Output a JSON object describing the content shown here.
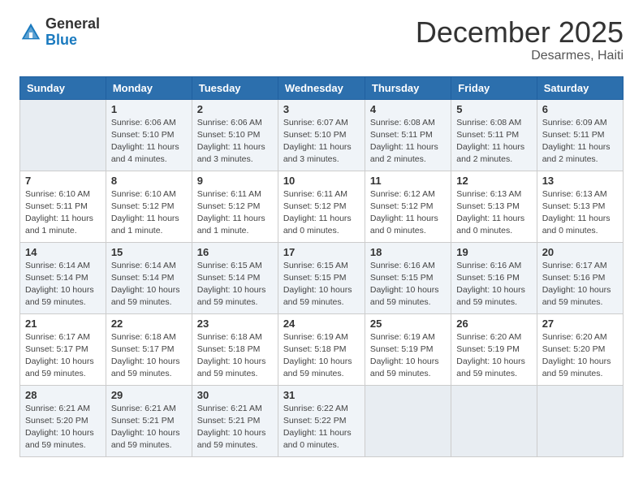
{
  "header": {
    "logo_general": "General",
    "logo_blue": "Blue",
    "title": "December 2025",
    "subtitle": "Desarmes, Haiti"
  },
  "columns": [
    "Sunday",
    "Monday",
    "Tuesday",
    "Wednesday",
    "Thursday",
    "Friday",
    "Saturday"
  ],
  "weeks": [
    [
      {
        "day": "",
        "info": ""
      },
      {
        "day": "1",
        "info": "Sunrise: 6:06 AM\nSunset: 5:10 PM\nDaylight: 11 hours\nand 4 minutes."
      },
      {
        "day": "2",
        "info": "Sunrise: 6:06 AM\nSunset: 5:10 PM\nDaylight: 11 hours\nand 3 minutes."
      },
      {
        "day": "3",
        "info": "Sunrise: 6:07 AM\nSunset: 5:10 PM\nDaylight: 11 hours\nand 3 minutes."
      },
      {
        "day": "4",
        "info": "Sunrise: 6:08 AM\nSunset: 5:11 PM\nDaylight: 11 hours\nand 2 minutes."
      },
      {
        "day": "5",
        "info": "Sunrise: 6:08 AM\nSunset: 5:11 PM\nDaylight: 11 hours\nand 2 minutes."
      },
      {
        "day": "6",
        "info": "Sunrise: 6:09 AM\nSunset: 5:11 PM\nDaylight: 11 hours\nand 2 minutes."
      }
    ],
    [
      {
        "day": "7",
        "info": "Sunrise: 6:10 AM\nSunset: 5:11 PM\nDaylight: 11 hours\nand 1 minute."
      },
      {
        "day": "8",
        "info": "Sunrise: 6:10 AM\nSunset: 5:12 PM\nDaylight: 11 hours\nand 1 minute."
      },
      {
        "day": "9",
        "info": "Sunrise: 6:11 AM\nSunset: 5:12 PM\nDaylight: 11 hours\nand 1 minute."
      },
      {
        "day": "10",
        "info": "Sunrise: 6:11 AM\nSunset: 5:12 PM\nDaylight: 11 hours\nand 0 minutes."
      },
      {
        "day": "11",
        "info": "Sunrise: 6:12 AM\nSunset: 5:12 PM\nDaylight: 11 hours\nand 0 minutes."
      },
      {
        "day": "12",
        "info": "Sunrise: 6:13 AM\nSunset: 5:13 PM\nDaylight: 11 hours\nand 0 minutes."
      },
      {
        "day": "13",
        "info": "Sunrise: 6:13 AM\nSunset: 5:13 PM\nDaylight: 11 hours\nand 0 minutes."
      }
    ],
    [
      {
        "day": "14",
        "info": "Sunrise: 6:14 AM\nSunset: 5:14 PM\nDaylight: 10 hours\nand 59 minutes."
      },
      {
        "day": "15",
        "info": "Sunrise: 6:14 AM\nSunset: 5:14 PM\nDaylight: 10 hours\nand 59 minutes."
      },
      {
        "day": "16",
        "info": "Sunrise: 6:15 AM\nSunset: 5:14 PM\nDaylight: 10 hours\nand 59 minutes."
      },
      {
        "day": "17",
        "info": "Sunrise: 6:15 AM\nSunset: 5:15 PM\nDaylight: 10 hours\nand 59 minutes."
      },
      {
        "day": "18",
        "info": "Sunrise: 6:16 AM\nSunset: 5:15 PM\nDaylight: 10 hours\nand 59 minutes."
      },
      {
        "day": "19",
        "info": "Sunrise: 6:16 AM\nSunset: 5:16 PM\nDaylight: 10 hours\nand 59 minutes."
      },
      {
        "day": "20",
        "info": "Sunrise: 6:17 AM\nSunset: 5:16 PM\nDaylight: 10 hours\nand 59 minutes."
      }
    ],
    [
      {
        "day": "21",
        "info": "Sunrise: 6:17 AM\nSunset: 5:17 PM\nDaylight: 10 hours\nand 59 minutes."
      },
      {
        "day": "22",
        "info": "Sunrise: 6:18 AM\nSunset: 5:17 PM\nDaylight: 10 hours\nand 59 minutes."
      },
      {
        "day": "23",
        "info": "Sunrise: 6:18 AM\nSunset: 5:18 PM\nDaylight: 10 hours\nand 59 minutes."
      },
      {
        "day": "24",
        "info": "Sunrise: 6:19 AM\nSunset: 5:18 PM\nDaylight: 10 hours\nand 59 minutes."
      },
      {
        "day": "25",
        "info": "Sunrise: 6:19 AM\nSunset: 5:19 PM\nDaylight: 10 hours\nand 59 minutes."
      },
      {
        "day": "26",
        "info": "Sunrise: 6:20 AM\nSunset: 5:19 PM\nDaylight: 10 hours\nand 59 minutes."
      },
      {
        "day": "27",
        "info": "Sunrise: 6:20 AM\nSunset: 5:20 PM\nDaylight: 10 hours\nand 59 minutes."
      }
    ],
    [
      {
        "day": "28",
        "info": "Sunrise: 6:21 AM\nSunset: 5:20 PM\nDaylight: 10 hours\nand 59 minutes."
      },
      {
        "day": "29",
        "info": "Sunrise: 6:21 AM\nSunset: 5:21 PM\nDaylight: 10 hours\nand 59 minutes."
      },
      {
        "day": "30",
        "info": "Sunrise: 6:21 AM\nSunset: 5:21 PM\nDaylight: 10 hours\nand 59 minutes."
      },
      {
        "day": "31",
        "info": "Sunrise: 6:22 AM\nSunset: 5:22 PM\nDaylight: 11 hours\nand 0 minutes."
      },
      {
        "day": "",
        "info": ""
      },
      {
        "day": "",
        "info": ""
      },
      {
        "day": "",
        "info": ""
      }
    ]
  ]
}
